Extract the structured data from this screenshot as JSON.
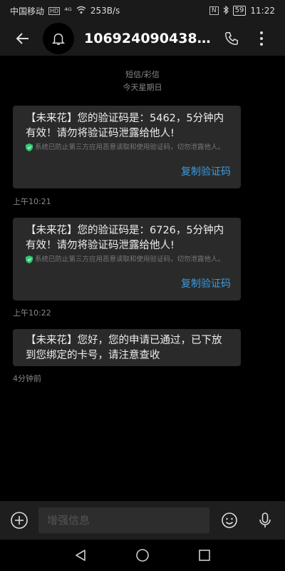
{
  "status": {
    "carrier": "中国移动",
    "hd": "HD",
    "signal": "⁴ᴳ",
    "speed": "253B/s",
    "nfc": "N",
    "battery": "59",
    "time": "11:22"
  },
  "header": {
    "contact": "10692409043877..."
  },
  "date": {
    "type": "短信/彩信",
    "day": "今天星期日"
  },
  "messages": [
    {
      "body": "【未来花】您的验证码是：5462，5分钟内有效！请勿将验证码泄露给他人!",
      "note": "系统已防止第三方应用恶意读取和使用验证码，切勿泄露他人。",
      "copy": "复制验证码",
      "time": "上午10:21"
    },
    {
      "body": "【未来花】您的验证码是：6726，5分钟内有效！请勿将验证码泄露给他人!",
      "note": "系统已防止第三方应用恶意读取和使用验证码，切勿泄露他人。",
      "copy": "复制验证码",
      "time": "上午10:22"
    },
    {
      "body": "【未来花】您好，您的申请已通过，已下放到您绑定的卡号，请注意查收",
      "time": "4分钟前"
    }
  ],
  "input": {
    "placeholder": "增强信息"
  },
  "icons": {
    "back": "back-arrow-icon",
    "avatar": "bell-icon",
    "call": "phone-icon",
    "more": "more-vertical-icon",
    "add": "add-circle-icon",
    "emoji": "emoji-icon",
    "voice": "microphone-icon",
    "nav_back": "triangle-back-icon",
    "nav_home": "circle-home-icon",
    "nav_recent": "square-recent-icon"
  },
  "colors": {
    "accent": "#3a9bdc",
    "bubble": "#2a2a2a",
    "shield": "#2ecc71"
  }
}
